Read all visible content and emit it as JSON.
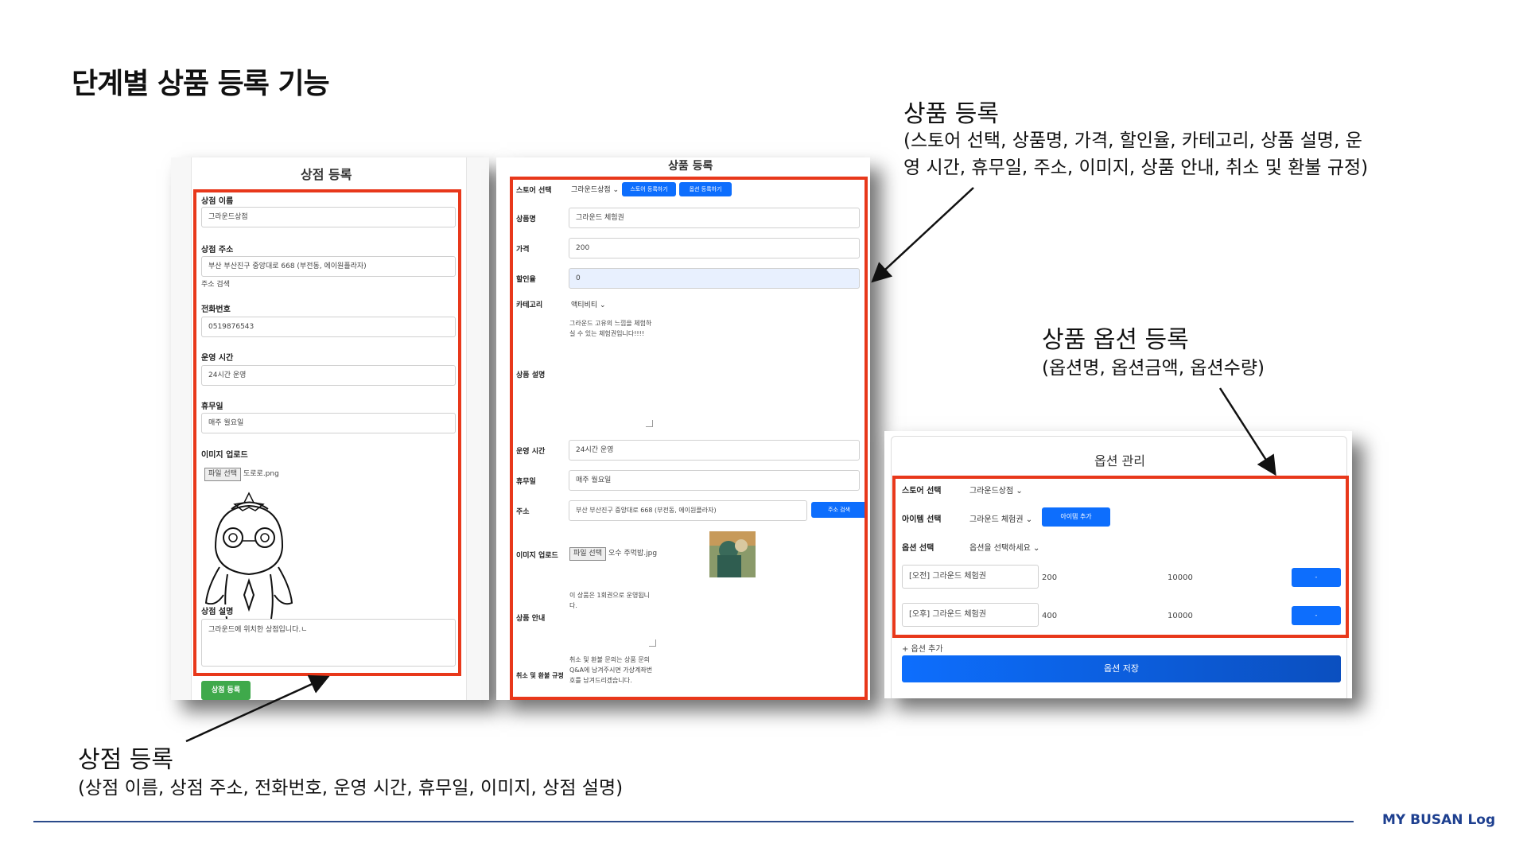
{
  "slide_title": "단계별 상품 등록 기능",
  "brand": "MY BUSAN Log",
  "captions": {
    "product": {
      "title": "상품 등록",
      "line1": "(스토어 선택, 상품명, 가격, 할인율, 카테고리, 상품 설명, 운",
      "line2": "영 시간, 휴무일, 주소, 이미지, 상품 안내, 취소 및 환불 규정)"
    },
    "option": {
      "title": "상품 옵션 등록",
      "line1": "(옵션명, 옵션금액, 옵션수량)"
    },
    "store": {
      "title": "상점 등록",
      "line1": "(상점 이름, 상점 주소, 전화번호, 운영 시간, 휴무일, 이미지, 상점 설명)"
    }
  },
  "store_form": {
    "title": "상점 등록",
    "name_label": "상점 이름",
    "name_value": "그라운드상점",
    "address_label": "상점 주소",
    "address_value": "부산 부산진구 중앙대로 668 (부전동, 에이원플라자)",
    "address_search": "주소 검색",
    "phone_label": "전화번호",
    "phone_value": "0519876543",
    "hours_label": "운영 시간",
    "hours_value": "24시간 운영",
    "holiday_label": "휴무일",
    "holiday_value": "매주 월요일",
    "image_label": "이미지 업로드",
    "file_button": "파일 선택",
    "file_name": "도로로.png",
    "desc_label": "상점 설명",
    "desc_value": "그라운드에 위치한 상점입니다.ㄴ",
    "submit": "상점 등록"
  },
  "product_form": {
    "title": "상품 등록",
    "store_label": "스토어 선택",
    "store_value": "그라운드상점",
    "store_register_btn": "스토어 등록하기",
    "option_register_btn": "옵션 등록하기",
    "name_label": "상품명",
    "name_value": "그라운드 체험권",
    "price_label": "가격",
    "price_value": "200",
    "discount_label": "할인율",
    "discount_value": "0",
    "category_label": "카테고리",
    "category_value": "액티비티",
    "desc_label": "상품 설명",
    "desc_value": "그라운드 고유의 느낌을 체험하실 수 있는 체험권입니다!!!!",
    "hours_label": "운영 시간",
    "hours_value": "24시간 운영",
    "holiday_label": "휴무일",
    "holiday_value": "매주 월요일",
    "address_label": "주소",
    "address_value": "부산 부산진구 중앙대로 668 (부전동, 에이원플라자)",
    "address_search": "주소 검색",
    "image_label": "이미지 업로드",
    "file_button": "파일 선택",
    "file_name": "오수 주먹밥.jpg",
    "guide_label": "상품 안내",
    "guide_value": "이 상품은 1회권으로 운영됩니다.",
    "refund_label": "취소 및 환불 규정",
    "refund_value": "취소 및 환불 문의는 상품 문의 Q&A에 남겨주시면 가상계좌번호를 남겨드리겠습니다."
  },
  "option_form": {
    "title": "옵션 관리",
    "store_label": "스토어 선택",
    "store_value": "그라운드상점",
    "item_label": "아이템 선택",
    "item_value": "그라운드 체험권",
    "item_add": "아이템 추가",
    "option_label": "옵션 선택",
    "option_value": "옵션을 선택하세요",
    "rows": [
      {
        "name": "[오전] 그라운드 체험권",
        "price": "200",
        "qty": "10000",
        "remove": "-"
      },
      {
        "name": "[오후] 그라운드 체험권",
        "price": "400",
        "qty": "10000",
        "remove": "-"
      }
    ],
    "add_option": "+ 옵션 추가",
    "save": "옵션 저장"
  }
}
